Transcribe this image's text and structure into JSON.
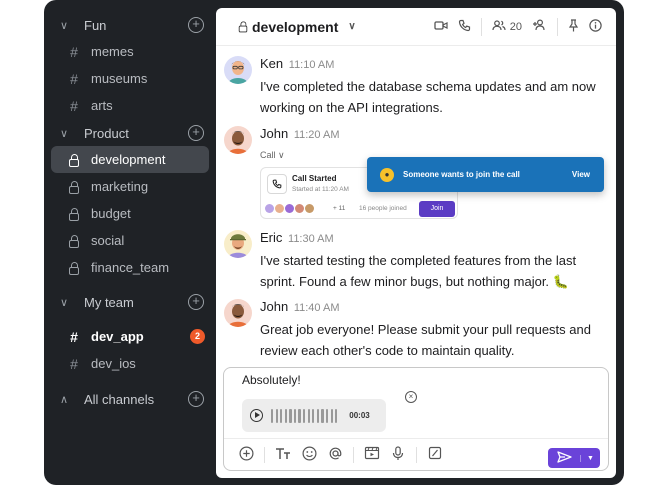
{
  "sidebar": {
    "sections": [
      {
        "label": "Fun",
        "channels": [
          {
            "name": "memes",
            "prefix": "#"
          },
          {
            "name": "museums",
            "prefix": "#"
          },
          {
            "name": "arts",
            "prefix": "#"
          }
        ]
      },
      {
        "label": "Product",
        "channels": [
          {
            "name": "development",
            "prefix": "lock"
          },
          {
            "name": "marketing",
            "prefix": "lock"
          },
          {
            "name": "budget",
            "prefix": "lock"
          },
          {
            "name": "social",
            "prefix": "lock"
          },
          {
            "name": "finance_team",
            "prefix": "lock"
          }
        ]
      },
      {
        "label": "My team",
        "channels": [
          {
            "name": "dev_app",
            "prefix": "#",
            "badge": "2"
          },
          {
            "name": "dev_ios",
            "prefix": "#"
          }
        ]
      },
      {
        "label": "All channels",
        "channels": []
      }
    ]
  },
  "header": {
    "channel": "development",
    "member_count": "20"
  },
  "messages": [
    {
      "name": "Ken",
      "time": "11:10 AM",
      "text": "I've completed the database schema updates and am now working on the API integrations."
    },
    {
      "name": "John",
      "time": "11:20 AM",
      "call_label": "Call",
      "call_title": "Call Started",
      "call_subtitle": "Started at 11:20 AM",
      "call_more": "+ 11",
      "call_joined": "16 people joined",
      "call_join": "Join"
    },
    {
      "name": "Eric",
      "time": "11:30 AM",
      "text": "I've started testing the completed features from the last sprint. Found a few minor bugs, but nothing major. 🐛"
    },
    {
      "name": "John",
      "time": "11:40 AM",
      "text": "Great job everyone! Please submit your pull requests and review each other's code to maintain quality."
    }
  ],
  "toast": {
    "text": "Someone wants to join the call",
    "action": "View"
  },
  "composer": {
    "draft": "Absolutely!",
    "voice_duration": "00:03"
  },
  "colors": {
    "accent": "#6a43d9",
    "toast": "#1a72b8",
    "badge": "#ef5a2a",
    "sidebar": "#1f2226"
  }
}
